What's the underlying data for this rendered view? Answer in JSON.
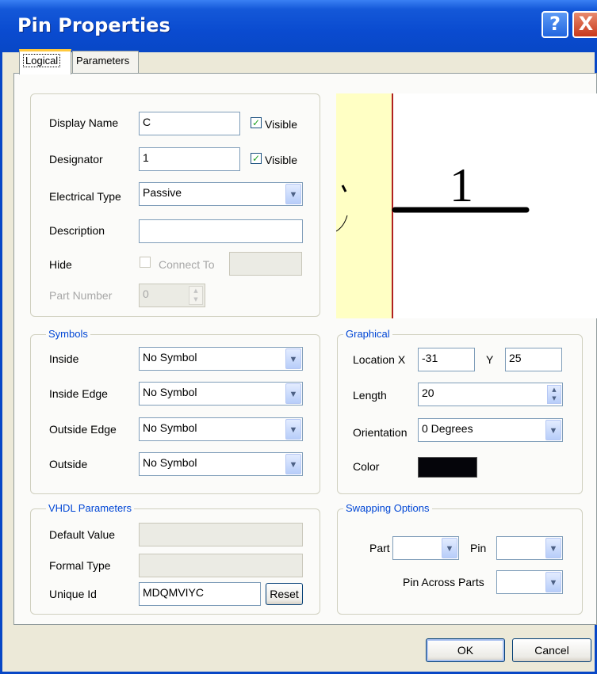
{
  "window": {
    "title": "Pin Properties",
    "help_glyph": "?",
    "close_glyph": "X"
  },
  "tabs": [
    {
      "label": "Logical"
    },
    {
      "label": "Parameters"
    }
  ],
  "properties": {
    "display_name_label": "Display Name",
    "display_name_value": "C",
    "display_visible_label": "Visible",
    "designator_label": "Designator",
    "designator_value": "1",
    "designator_visible_label": "Visible",
    "electrical_type_label": "Electrical Type",
    "electrical_type_value": "Passive",
    "description_label": "Description",
    "description_value": "",
    "hide_label": "Hide",
    "connect_to_label": "Connect To",
    "part_number_label": "Part Number",
    "part_number_value": "0"
  },
  "preview": {
    "pin_number": "1"
  },
  "symbols": {
    "title": "Symbols",
    "inside_label": "Inside",
    "inside_value": "No Symbol",
    "inside_edge_label": "Inside Edge",
    "inside_edge_value": "No Symbol",
    "outside_edge_label": "Outside Edge",
    "outside_edge_value": "No Symbol",
    "outside_label": "Outside",
    "outside_value": "No Symbol"
  },
  "graphical": {
    "title": "Graphical",
    "location_x_label": "Location X",
    "location_x_value": "-31",
    "location_y_label": "Y",
    "location_y_value": "25",
    "length_label": "Length",
    "length_value": "20",
    "orientation_label": "Orientation",
    "orientation_value": "0 Degrees",
    "color_label": "Color",
    "color_value": "#05050a"
  },
  "vhdl": {
    "title": "VHDL Parameters",
    "default_value_label": "Default Value",
    "formal_type_label": "Formal Type",
    "unique_id_label": "Unique Id",
    "unique_id_value": "MDQMVIYC",
    "reset_label": "Reset"
  },
  "swapping": {
    "title": "Swapping Options",
    "part_label": "Part",
    "pin_label": "Pin",
    "pin_across_parts_label": "Pin Across Parts"
  },
  "footer": {
    "ok_label": "OK",
    "cancel_label": "Cancel"
  },
  "icons": {
    "checkbox_check": "✓",
    "dropdown": "▼",
    "spin_up": "▲",
    "spin_down": "▼"
  }
}
